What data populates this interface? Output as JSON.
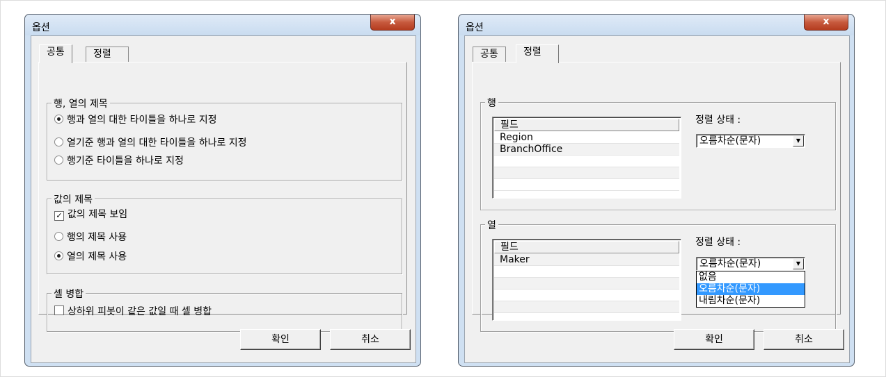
{
  "left_dialog": {
    "title": "옵션",
    "close_label": "x",
    "tabs": [
      "공통",
      "정렬"
    ],
    "group1": {
      "legend": "행, 열의 제목",
      "options": [
        {
          "label": "행과 열의 대한 타이틀을 하나로 지정",
          "checked": true
        },
        {
          "label": "열기준 행과 열의 대한 타이틀을 하나로 지정",
          "checked": false
        },
        {
          "label": "행기준 타이틀을 하나로 지정",
          "checked": false
        }
      ]
    },
    "group2": {
      "legend": "값의 제목",
      "checkbox_label": "값의 제목 보임",
      "checkbox_checked": true,
      "options": [
        {
          "label": "행의 제목 사용",
          "checked": false
        },
        {
          "label": "열의 제목 사용",
          "checked": true
        }
      ]
    },
    "group3": {
      "legend": "셀 병합",
      "checkbox_label": "상하위 피봇이 같은 값일 때 셀 병합",
      "checkbox_checked": false
    },
    "ok_label": "확인",
    "cancel_label": "취소"
  },
  "right_dialog": {
    "title": "옵션",
    "close_label": "x",
    "tabs": [
      "공통",
      "정렬"
    ],
    "row_group": {
      "legend": "행",
      "column_header": "필드",
      "items": [
        "Region",
        "BranchOffice"
      ],
      "sort_label": "정렬 상태 :",
      "sort_value": "오름차순(문자)"
    },
    "col_group": {
      "legend": "열",
      "column_header": "필드",
      "items": [
        "Maker"
      ],
      "sort_label": "정렬 상태 :",
      "sort_value": "오름차순(문자)",
      "dropdown_options": [
        "없음",
        "오름차순(문자)",
        "내림차순(문자)"
      ],
      "dropdown_selected_index": 1
    },
    "ok_label": "확인",
    "cancel_label": "취소"
  }
}
